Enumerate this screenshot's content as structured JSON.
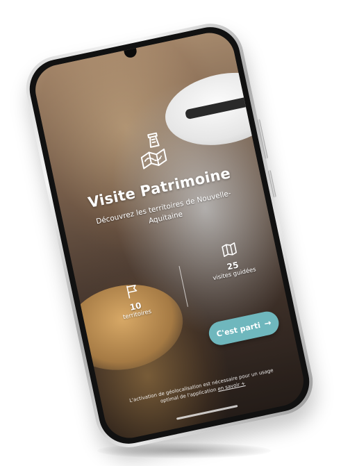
{
  "app": {
    "title": "Visite Patrimoine",
    "subtitle": "Découvrez les territoires de Nouvelle-Aquitaine"
  },
  "stats": {
    "territories": {
      "value": "10",
      "label": "territoires",
      "icon": "flag-icon"
    },
    "visits": {
      "value": "25",
      "label": "visites guidées",
      "icon": "map-icon"
    }
  },
  "cta": {
    "label": "C'est parti",
    "icon": "arrow-right-icon"
  },
  "footer": {
    "text": "L'activation de géolocalisation est nécessaire pour un usage",
    "text2": "optimal de l'application",
    "link": "en savoir +"
  },
  "colors": {
    "accent": "#6fb7bd",
    "text": "#ffffff"
  },
  "icons": {
    "logo": "tower-map-logo-icon"
  }
}
